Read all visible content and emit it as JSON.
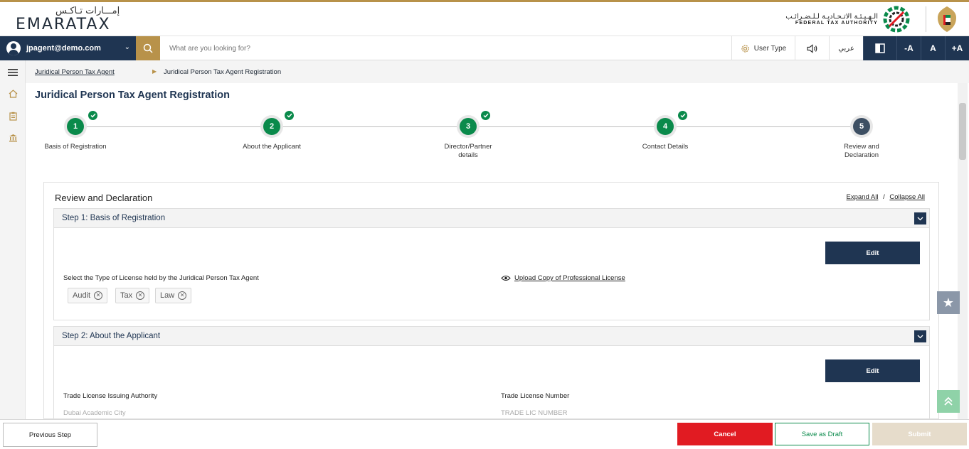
{
  "header": {
    "logo_ar": "إمـــارات تـاكـس",
    "logo_en": "EMARATAX",
    "fta_ar": "الـهـيـئـة الاتـحـاديـة لـلـضـرائـب",
    "fta_en": "FEDERAL TAX AUTHORITY"
  },
  "toolbar": {
    "user_email": "jpagent@demo.com",
    "search_placeholder": "What are you looking for?",
    "user_type_label": "User Type",
    "arabic_label": "عربي",
    "font_decrease": "-A",
    "font_reset": "A",
    "font_increase": "+A"
  },
  "breadcrumb": {
    "parent": "Juridical Person Tax Agent",
    "current": "Juridical Person Tax Agent Registration"
  },
  "page": {
    "title": "Juridical Person Tax Agent Registration"
  },
  "stepper": {
    "steps": [
      {
        "number": "1",
        "label": "Basis of Registration",
        "status": "done"
      },
      {
        "number": "2",
        "label": "About the Applicant",
        "status": "done"
      },
      {
        "number": "3",
        "label": "Director/Partner details",
        "status": "done"
      },
      {
        "number": "4",
        "label": "Contact Details",
        "status": "done"
      },
      {
        "number": "5",
        "label": "Review and Declaration",
        "status": "active"
      }
    ]
  },
  "review": {
    "title": "Review and Declaration",
    "expand_all": "Expand All",
    "separator": "/",
    "collapse_all": "Collapse All",
    "step1": {
      "title": "Step 1: Basis of Registration",
      "edit_label": "Edit",
      "license_label": "Select the Type of License held by the Juridical Person Tax Agent",
      "chips": [
        "Audit",
        "Tax",
        "Law"
      ],
      "upload_label": "Upload Copy of Professional License"
    },
    "step2": {
      "title": "Step 2: About the Applicant",
      "edit_label": "Edit",
      "authority_label": "Trade License Issuing Authority",
      "authority_value": "Dubai Academic City",
      "license_number_label": "Trade License Number",
      "license_number_value": "TRADE LIC NUMBER"
    }
  },
  "footer": {
    "previous": "Previous Step",
    "cancel": "Cancel",
    "save_draft": "Save as Draft",
    "submit": "Submit"
  },
  "colors": {
    "navy": "#1f3552",
    "gold": "#b8924a",
    "green": "#0a8a4b",
    "red": "#e11b22"
  },
  "icons": [
    "user-avatar-icon",
    "chevron-down-icon",
    "search-icon",
    "gear-icon",
    "speaker-icon",
    "contrast-icon",
    "menu-icon",
    "home-icon",
    "clipboard-icon",
    "bank-icon",
    "check-icon",
    "eye-icon",
    "star-icon",
    "double-chevron-up-icon"
  ]
}
